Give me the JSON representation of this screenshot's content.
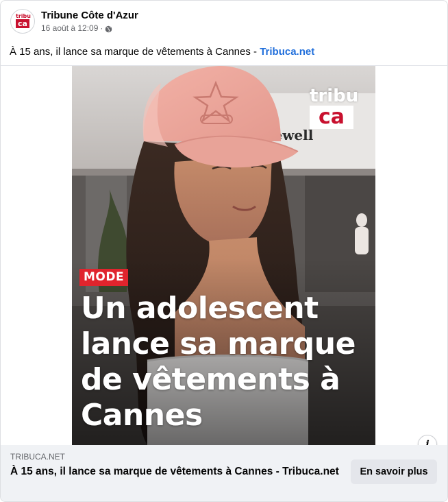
{
  "post": {
    "page_name": "Tribune Côte d'Azur",
    "date": "16 août à 12:09",
    "separator": "·",
    "privacy_icon": "globe-icon",
    "caption_text": "À 15 ans, il lance sa marque de vêtements à Cannes  - ",
    "caption_link": "Tribuca.net"
  },
  "avatar": {
    "line1": "tribu",
    "line2": "ca"
  },
  "image": {
    "logo_line1": "tribu",
    "logo_line2": "ca",
    "badge": "MODE",
    "headline": "Un adolescent lance sa marque de vêtements à Cannes",
    "store_sign": "Jewell"
  },
  "link_preview": {
    "domain": "TRIBUCA.NET",
    "title": "À 15 ans, il lance sa marque de vêtements à Cannes - Tribuca.net",
    "cta_label": "En savoir plus",
    "info_icon": "info-icon"
  },
  "colors": {
    "accent_link": "#216fdb",
    "badge_red": "#e0242d",
    "footer_bg": "#f0f2f5",
    "button_bg": "#e4e6eb"
  }
}
